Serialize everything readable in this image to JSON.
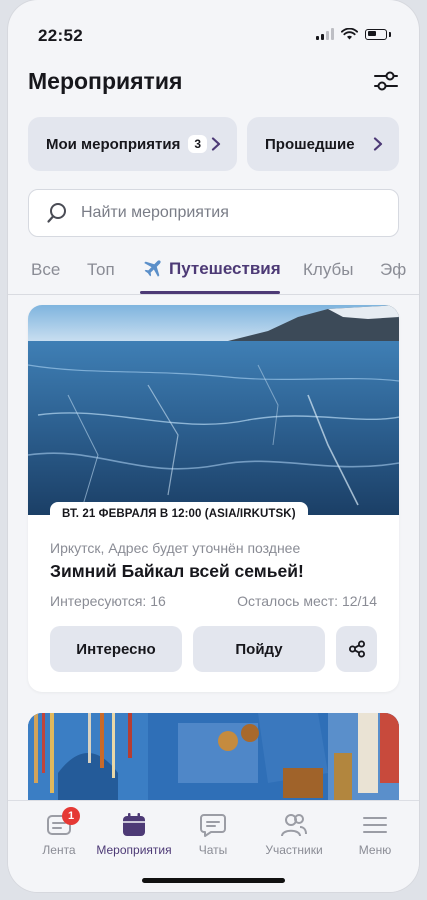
{
  "status_bar": {
    "time": "22:52"
  },
  "header": {
    "title": "Мероприятия",
    "filter_icon": "sliders-icon"
  },
  "quick_links": {
    "my_events": {
      "label": "Мои мероприятия",
      "count": "3"
    },
    "past": {
      "label": "Прошедшие"
    }
  },
  "search": {
    "placeholder": "Найти мероприятия"
  },
  "tabs": [
    {
      "label": "Все"
    },
    {
      "label": "Топ"
    },
    {
      "label": "Путешествия",
      "icon": "airplane-icon",
      "active": true
    },
    {
      "label": "Клубы"
    },
    {
      "label": "Эф"
    }
  ],
  "event": {
    "date": "ВТ. 21 ФЕВРАЛЯ В 12:00 (ASIA/IRKUTSK)",
    "location": "Иркутск, Адрес будет уточнён позднее",
    "title": "Зимний Байкал всей семьей!",
    "interested": "Интересуются: 16",
    "seats_left": "Осталось мест: 12/14",
    "btn_interested": "Интересно",
    "btn_going": "Пойду",
    "share_icon": "share-icon"
  },
  "bottom_nav": [
    {
      "label": "Лента",
      "icon": "feed-icon",
      "badge": "1"
    },
    {
      "label": "Мероприятия",
      "icon": "calendar-icon",
      "active": true
    },
    {
      "label": "Чаты",
      "icon": "chat-icon"
    },
    {
      "label": "Участники",
      "icon": "people-icon"
    },
    {
      "label": "Меню",
      "icon": "menu-icon"
    }
  ],
  "colors": {
    "accent": "#4d3a76",
    "badge": "#e53935",
    "tile": "#e3e6ee"
  }
}
